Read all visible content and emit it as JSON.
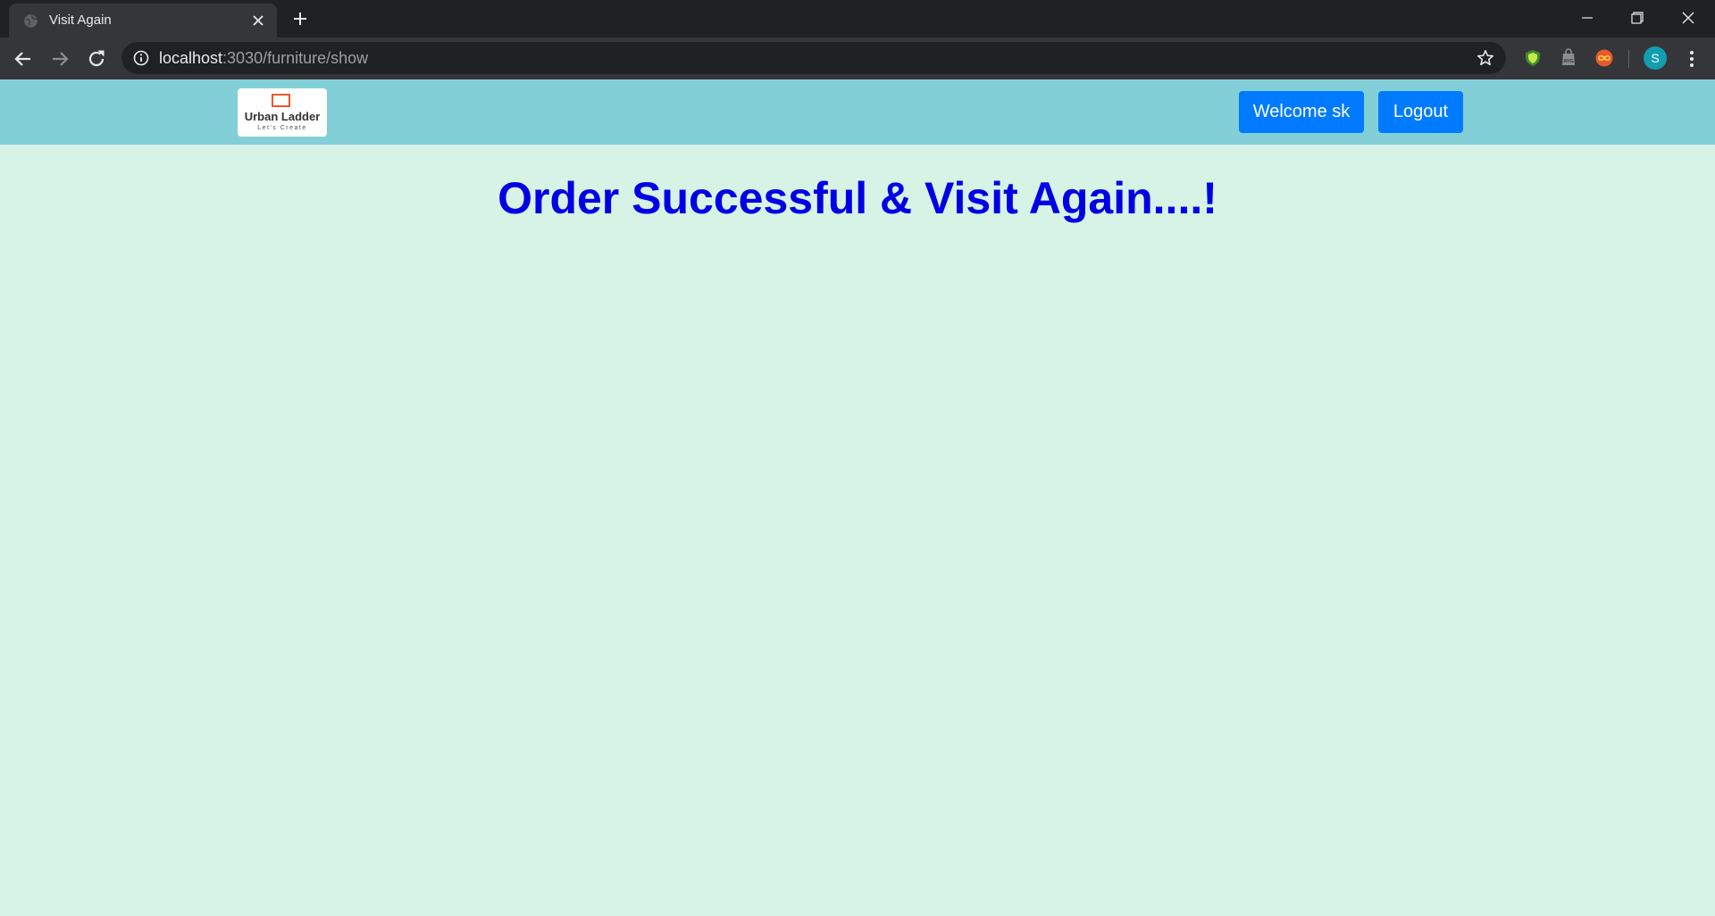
{
  "browser": {
    "tab_title": "Visit Again",
    "url_host": "localhost",
    "url_path": ":3030/furniture/show",
    "profile_initial": "S"
  },
  "site": {
    "logo_name": "Urban Ladder",
    "logo_tagline": "Let's Create",
    "welcome_label": "Welcome sk",
    "logout_label": "Logout",
    "message": "Order Successful & Visit Again....!"
  },
  "colors": {
    "header_bg": "#82cfd8",
    "page_bg": "#d6f3e6",
    "button_bg": "#007bff",
    "headline": "#0000e6"
  }
}
